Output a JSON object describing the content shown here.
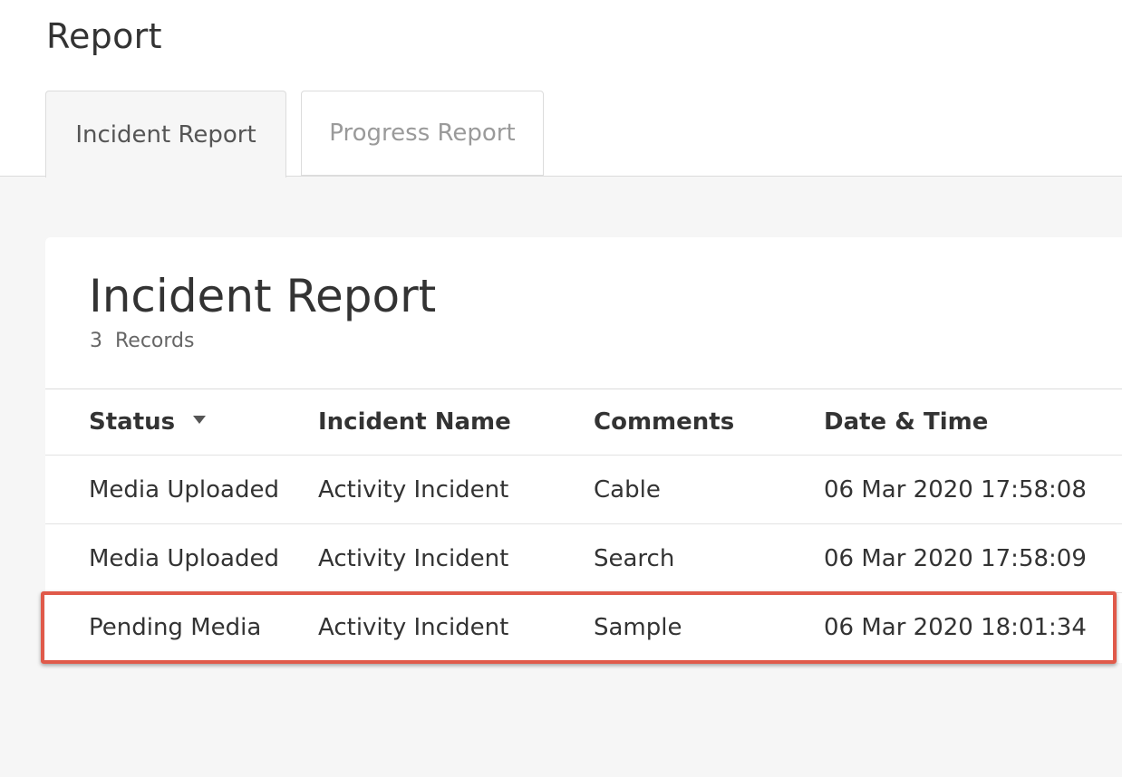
{
  "page": {
    "title": "Report"
  },
  "tabs": [
    {
      "label": "Incident Report",
      "active": true
    },
    {
      "label": "Progress Report",
      "active": false
    }
  ],
  "card": {
    "title": "Incident Report",
    "count": "3  Records"
  },
  "table": {
    "columns": [
      "Status",
      "Incident Name",
      "Comments",
      "Date & Time"
    ],
    "sort_icon": "caret-down-icon",
    "rows": [
      {
        "status": "Media Uploaded",
        "name": "Activity Incident",
        "comments": "Cable",
        "datetime": "06 Mar 2020 17:58:08"
      },
      {
        "status": "Media Uploaded",
        "name": "Activity Incident",
        "comments": "Search",
        "datetime": "06 Mar 2020 17:58:09"
      },
      {
        "status": "Pending Media",
        "name": "Activity Incident",
        "comments": "Sample",
        "datetime": "06 Mar 2020 18:01:34"
      }
    ]
  },
  "colors": {
    "highlight": "#e05a4a",
    "background": "#f6f6f6"
  }
}
